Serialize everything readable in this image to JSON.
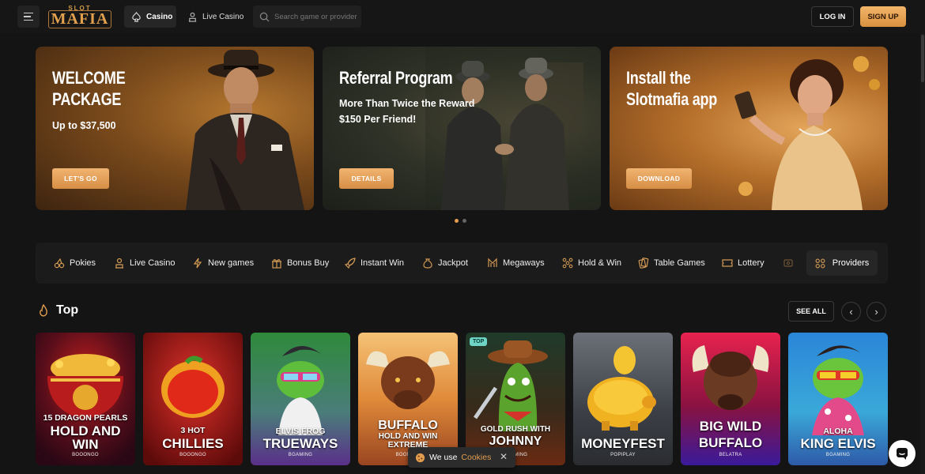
{
  "header": {
    "logo_small": "SLOT",
    "logo_main": "MAFIA",
    "nav": [
      {
        "label": "Casino",
        "active": true
      },
      {
        "label": "Live Casino",
        "active": false
      }
    ],
    "search_placeholder": "Search game or provider",
    "login_label": "LOG IN",
    "signup_label": "SIGN UP"
  },
  "banners": [
    {
      "title_line1": "WELCOME",
      "title_line2": "PACKAGE",
      "subtitle": "Up to $37,500",
      "cta": "LET'S GO"
    },
    {
      "title_line1": "Referral Program",
      "subtitle_line1": "More Than Twice the Reward",
      "subtitle_line2": "$150 Per Friend!",
      "cta": "DETAILS"
    },
    {
      "title_line1": "Install the",
      "title_line2": "Slotmafia app",
      "cta": "DOWNLOAD"
    }
  ],
  "carousel": {
    "pages": 2,
    "active": 1
  },
  "categories": [
    {
      "label": "Pokies",
      "icon": "cherries-icon"
    },
    {
      "label": "Live Casino",
      "icon": "dealer-icon"
    },
    {
      "label": "New games",
      "icon": "lightning-icon"
    },
    {
      "label": "Bonus Buy",
      "icon": "gift-icon"
    },
    {
      "label": "Instant Win",
      "icon": "rocket-icon"
    },
    {
      "label": "Jackpot",
      "icon": "moneybag-icon"
    },
    {
      "label": "Megaways",
      "icon": "megaways-icon"
    },
    {
      "label": "Hold & Win",
      "icon": "dots-icon"
    },
    {
      "label": "Table Games",
      "icon": "cards-icon"
    },
    {
      "label": "Lottery",
      "icon": "ticket-icon"
    }
  ],
  "providers_label": "Providers",
  "top": {
    "title": "Top",
    "see_all": "SEE ALL",
    "games": [
      {
        "line1": "15 DRAGON PEARLS",
        "line2": "HOLD AND",
        "line3": "WIN",
        "provider": "BOOONGO"
      },
      {
        "line1": "3 HOT",
        "line2": "CHILLIES",
        "provider": "BOOONGO"
      },
      {
        "line1": "ELVIS FROG",
        "line2": "TRUEWAYS",
        "provider": "BGAMING"
      },
      {
        "line1": "BUFFALO",
        "line2": "HOLD AND WIN",
        "line3": "EXTREME",
        "provider": "BOOMING"
      },
      {
        "badge": "TOP",
        "line1": "GOLD RUSH WITH",
        "line2": "JOHNNY",
        "provider": "BGAMING"
      },
      {
        "line1": "MONEYFEST",
        "provider": "POPIPLAY"
      },
      {
        "line1": "BIG WILD",
        "line2": "BUFFALO",
        "provider": "BELATRA"
      },
      {
        "line1": "ALOHA",
        "line2": "KING ELVIS",
        "provider": "BGAMING"
      }
    ]
  },
  "cookie": {
    "text": "We use",
    "link": "Cookies"
  }
}
